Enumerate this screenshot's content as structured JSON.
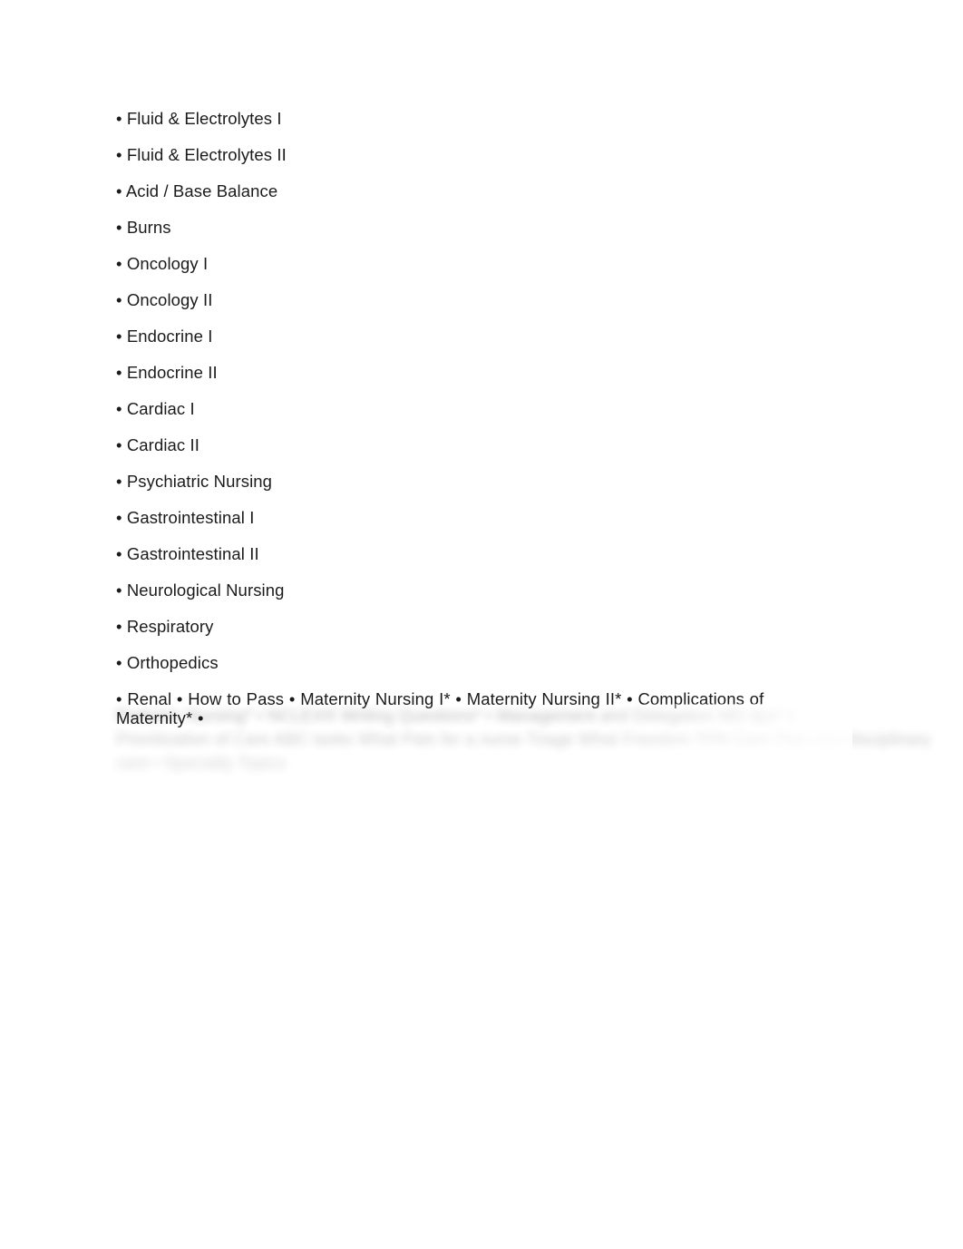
{
  "document": {
    "background_color": "#ffffff",
    "text_color": "#1b1b1b",
    "bullet_glyph": "•",
    "list_items": [
      {
        "bullet": "•",
        "label": "Fluid & Electrolytes I"
      },
      {
        "bullet": "•",
        "label": "Fluid & Electrolytes II"
      },
      {
        "bullet": "•",
        "label": "Acid / Base Balance"
      },
      {
        "bullet": "•",
        "label": "Burns"
      },
      {
        "bullet": "•",
        "label": "Oncology I"
      },
      {
        "bullet": "•",
        "label": "Oncology II"
      },
      {
        "bullet": "•",
        "label": "Endocrine I"
      },
      {
        "bullet": "•",
        "label": "Endocrine II"
      },
      {
        "bullet": "•",
        "label": "Cardiac I"
      },
      {
        "bullet": "•",
        "label": "Cardiac II"
      },
      {
        "bullet": "•",
        "label": "Psychiatric Nursing"
      },
      {
        "bullet": "•",
        "label": "Gastrointestinal I"
      },
      {
        "bullet": "•",
        "label": "Gastrointestinal II"
      },
      {
        "bullet": "•",
        "label": "Neurological Nursing"
      },
      {
        "bullet": "•",
        "label": "Respiratory"
      },
      {
        "bullet": "•",
        "label": "Orthopedics"
      }
    ],
    "run_on_paragraph": "• Renal • How to Pass • Maternity Nursing I* • Maternity Nursing II* • Complications of Maternity* •",
    "faded_lines": [
      "Pediatric Nursing* • NCLEX® Writing Questions* • Management and Delegation MD tips* •",
      "Prioritization of Care ABC tasks What Pain for a nurse Triage What Freedom TPN Care Plan interdisciplinary",
      "care • Specialty Topics"
    ]
  }
}
